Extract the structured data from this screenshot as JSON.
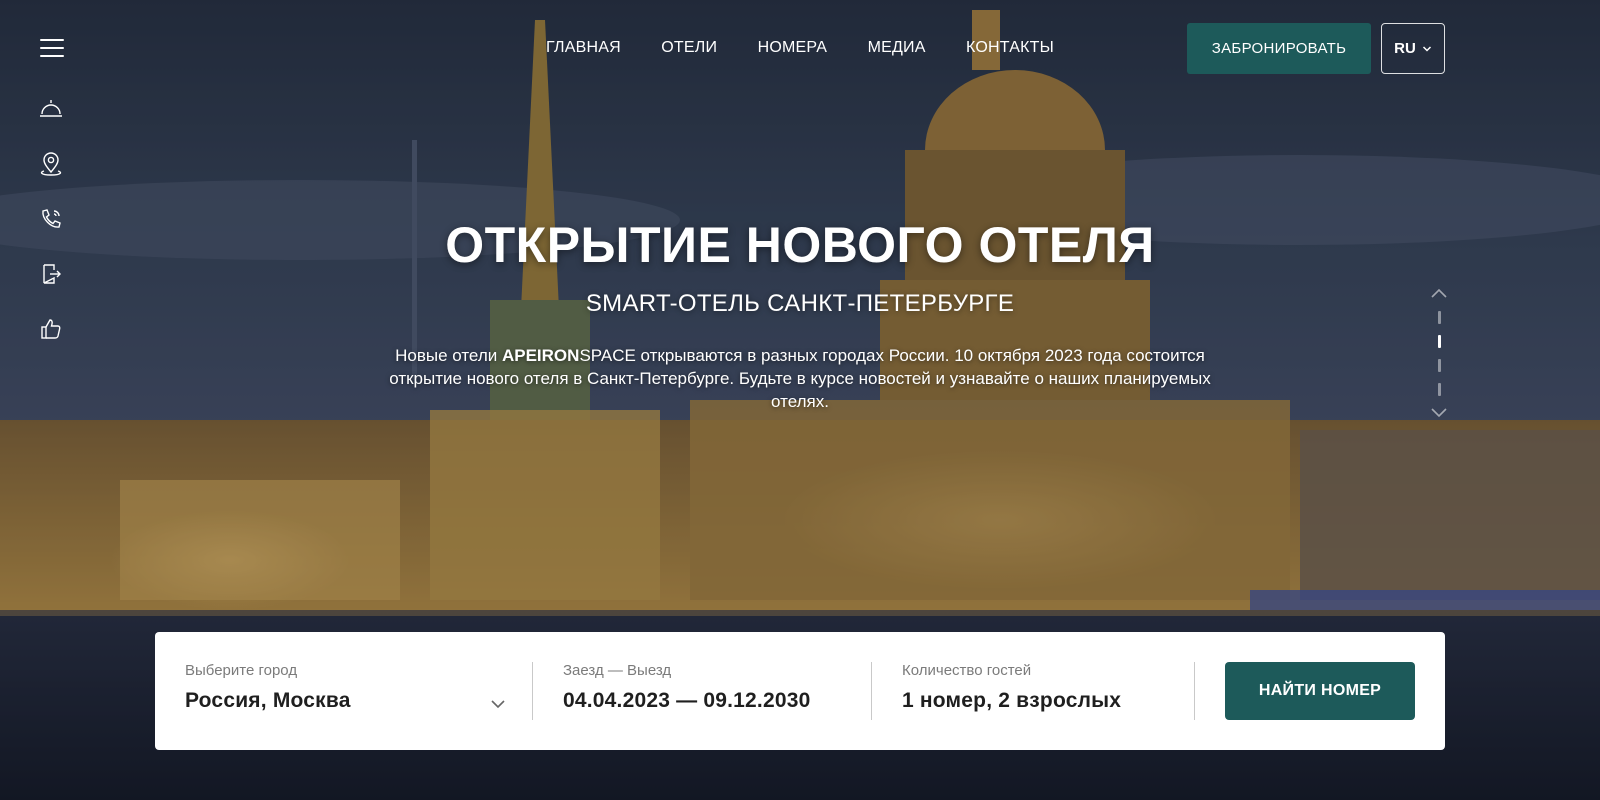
{
  "nav": {
    "items": [
      "ГЛАВНАЯ",
      "ОТЕЛИ",
      "НОМЕРА",
      "МЕДИА",
      "КОНТАКТЫ"
    ],
    "book_label": "ЗАБРОНИРОВАТЬ",
    "lang_label": "RU"
  },
  "sidebar": {
    "icons": [
      "menu-icon",
      "reception-bell-icon",
      "location-pin-icon",
      "phone-icon",
      "door-checkout-icon",
      "thumbs-up-icon"
    ]
  },
  "hero": {
    "title": "ОТКРЫТИЕ НОВОГО ОТЕЛЯ",
    "subtitle": "SMART-ОТЕЛЬ САНКТ-ПЕТЕРБУРГЕ",
    "text_before": "Новые отели ",
    "brand_bold": "APEIRON",
    "brand_rest": "SPACE",
    "text_after": " открываются в разных городах России. 10 октября 2023 года состоится открытие нового отеля в Санкт-Петербурге. Будьте в курсе новостей и узнавайте о наших планируемых отелях."
  },
  "slider": {
    "count": 4,
    "active": 2
  },
  "booking": {
    "city_label": "Выберите город",
    "city_value": "Россия, Москва",
    "dates_label": "Заезд — Выезд",
    "dates_value": "04.04.2023 — 09.12.2030",
    "guests_label": "Количество гостей",
    "guests_value": "1 номер, 2 взрослых",
    "search_label": "НАЙТИ НОМЕР"
  },
  "colors": {
    "accent": "#1d5a5a",
    "bar_bg": "#ffffff"
  }
}
